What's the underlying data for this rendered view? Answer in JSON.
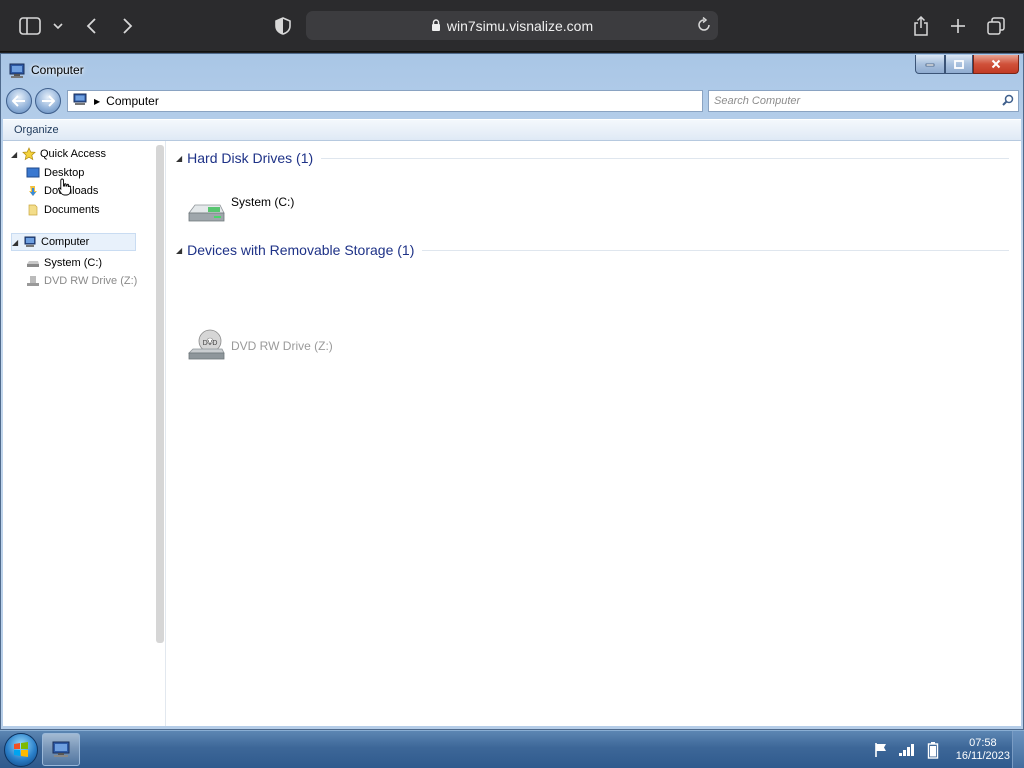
{
  "browser": {
    "url": "win7simu.visnalize.com",
    "icons": [
      "sidebar-icon",
      "chevron-down-icon",
      "back-icon",
      "forward-icon",
      "shield-icon",
      "lock-icon",
      "reload-icon",
      "share-icon",
      "new-tab-icon",
      "tabs-overview-icon"
    ]
  },
  "window": {
    "title": "Computer",
    "address": "Computer",
    "search_placeholder": "Search Computer",
    "command_bar": {
      "organize": "Organize"
    }
  },
  "nav_pane": {
    "quick_access": "Quick Access",
    "desktop": "Desktop",
    "downloads": "Downloads",
    "documents": "Documents",
    "computer": "Computer",
    "system_c": "System (C:)",
    "dvd_z": "DVD RW Drive (Z:)"
  },
  "groups": {
    "hard_disk": {
      "title": "Hard Disk Drives (1)",
      "items": [
        "System (C:)"
      ]
    },
    "removable": {
      "title": "Devices with Removable Storage (1)",
      "items": [
        "DVD RW Drive (Z:)"
      ]
    }
  },
  "taskbar": {
    "time": "07:58",
    "date": "16/11/2023"
  },
  "colors": {
    "accent": "#1e3287",
    "titlebar": "#a9c6e6",
    "taskbar": "#3d6798",
    "close_button": "#c23a24"
  }
}
